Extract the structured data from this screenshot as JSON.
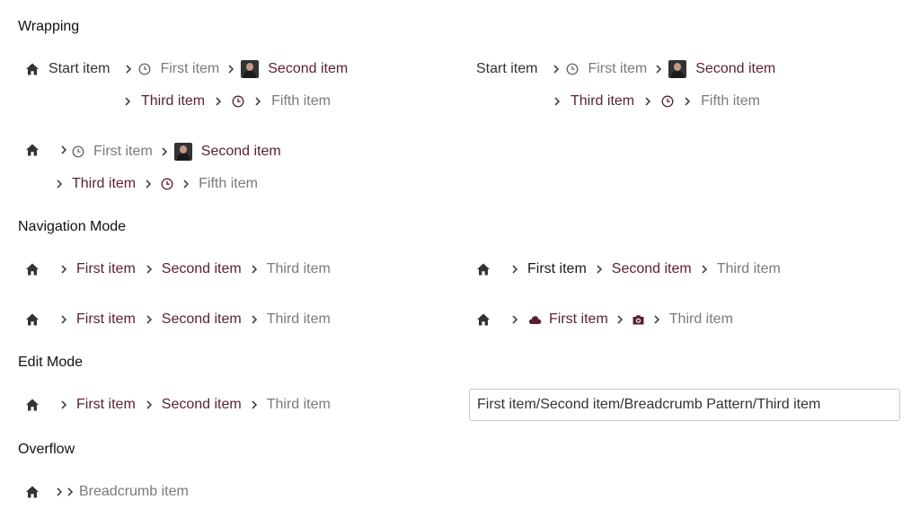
{
  "sections": {
    "wrapping": "Wrapping",
    "navigation": "Navigation Mode",
    "edit": "Edit Mode",
    "overflow": "Overflow"
  },
  "wrap1": {
    "start": "Start item",
    "first": "First item",
    "second": "Second item",
    "third": "Third item",
    "fifth": "Fifth item"
  },
  "wrap2": {
    "start": "Start item",
    "first": "First item",
    "second": "Second item",
    "third": "Third item",
    "fifth": "Fifth item"
  },
  "wrap3": {
    "first": "First item",
    "second": "Second item",
    "third": "Third item",
    "fifth": "Fifth item"
  },
  "nav1": {
    "first": "First item",
    "second": "Second item",
    "third": "Third item"
  },
  "nav2": {
    "first": "First item",
    "second": "Second item",
    "third": "Third item"
  },
  "nav3": {
    "first": "First item",
    "second": "Second item",
    "third": "Third item"
  },
  "nav4": {
    "first": "First item",
    "third": "Third item"
  },
  "edit": {
    "first": "First item",
    "second": "Second item",
    "third": "Third item",
    "field_value": "First item/Second item/Breadcrumb Pattern/Third item"
  },
  "overflow": {
    "item": "Breadcrumb item"
  },
  "icons": {
    "home": "home-icon",
    "chevron": "chevron-right-icon",
    "clock": "clock-icon",
    "avatar": "avatar-image",
    "cloud": "cloud-icon",
    "camera": "camera-icon"
  },
  "colors": {
    "link": "#5b1f35",
    "current": "#7a7a7a",
    "text": "#111111"
  }
}
